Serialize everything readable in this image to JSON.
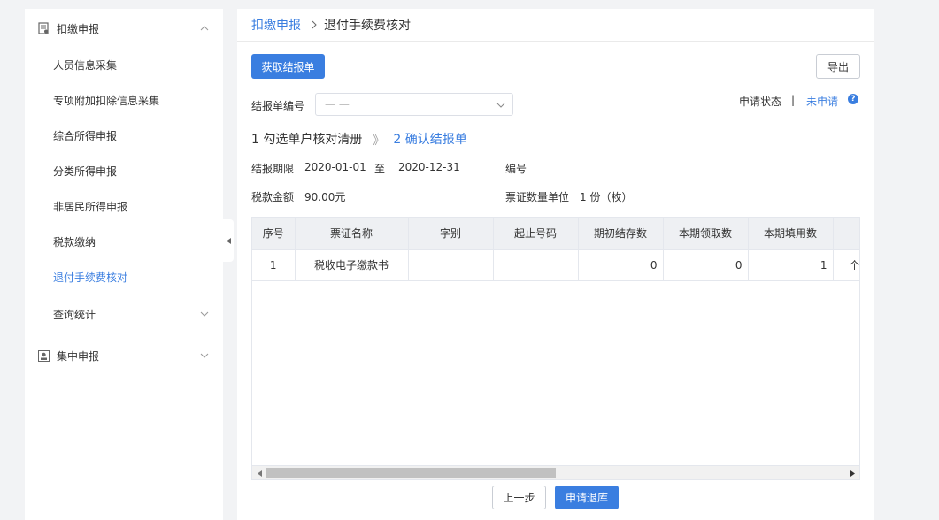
{
  "sidebar": {
    "group1": {
      "label": "扣缴申报"
    },
    "items": [
      {
        "label": "人员信息采集"
      },
      {
        "label": "专项附加扣除信息采集"
      },
      {
        "label": "综合所得申报"
      },
      {
        "label": "分类所得申报"
      },
      {
        "label": "非居民所得申报"
      },
      {
        "label": "税款缴纳"
      },
      {
        "label": "退付手续费核对",
        "active": true
      },
      {
        "label": "查询统计"
      }
    ],
    "group2": {
      "label": "集中申报"
    }
  },
  "breadcrumb": {
    "parent": "扣缴申报",
    "current": "退付手续费核对"
  },
  "toolbar": {
    "fetch_label": "获取结报单",
    "export_label": "导出"
  },
  "form": {
    "report_no_label": "结报单编号",
    "report_no_placeholder": "— —",
    "status_label": "申请状态",
    "status_sep": "|",
    "status_value": "未申请",
    "help_icon": "?"
  },
  "steps": {
    "step1": "1 勾选单户核对清册",
    "sep": "》",
    "step2": "2 确认结报单"
  },
  "info": {
    "period_label": "结报期限",
    "period_start": "2020-01-01",
    "period_to": "至",
    "period_end": "2020-12-31",
    "number_label": "编号",
    "tax_label": "税款金额",
    "tax_value": "90.00元",
    "unit_label": "票证数量单位",
    "unit_value": "1 份（枚）"
  },
  "table": {
    "headers": [
      "序号",
      "票证名称",
      "字别",
      "起止号码",
      "期初结存数",
      "本期领取数",
      "本期填用数",
      ""
    ],
    "rows": [
      [
        "1",
        "税收电子缴款书",
        "",
        "",
        "0",
        "0",
        "1",
        "个"
      ]
    ]
  },
  "footer": {
    "prev_label": "上一步",
    "apply_label": "申请退库"
  },
  "colors": {
    "accent": "#3a7ee0"
  },
  "icons": [
    "document-icon",
    "chevron-up-icon",
    "chevron-down-icon",
    "user-card-icon",
    "collapse-left-icon",
    "chevron-right-icon",
    "help-icon",
    "scroll-left-icon",
    "scroll-right-icon"
  ]
}
